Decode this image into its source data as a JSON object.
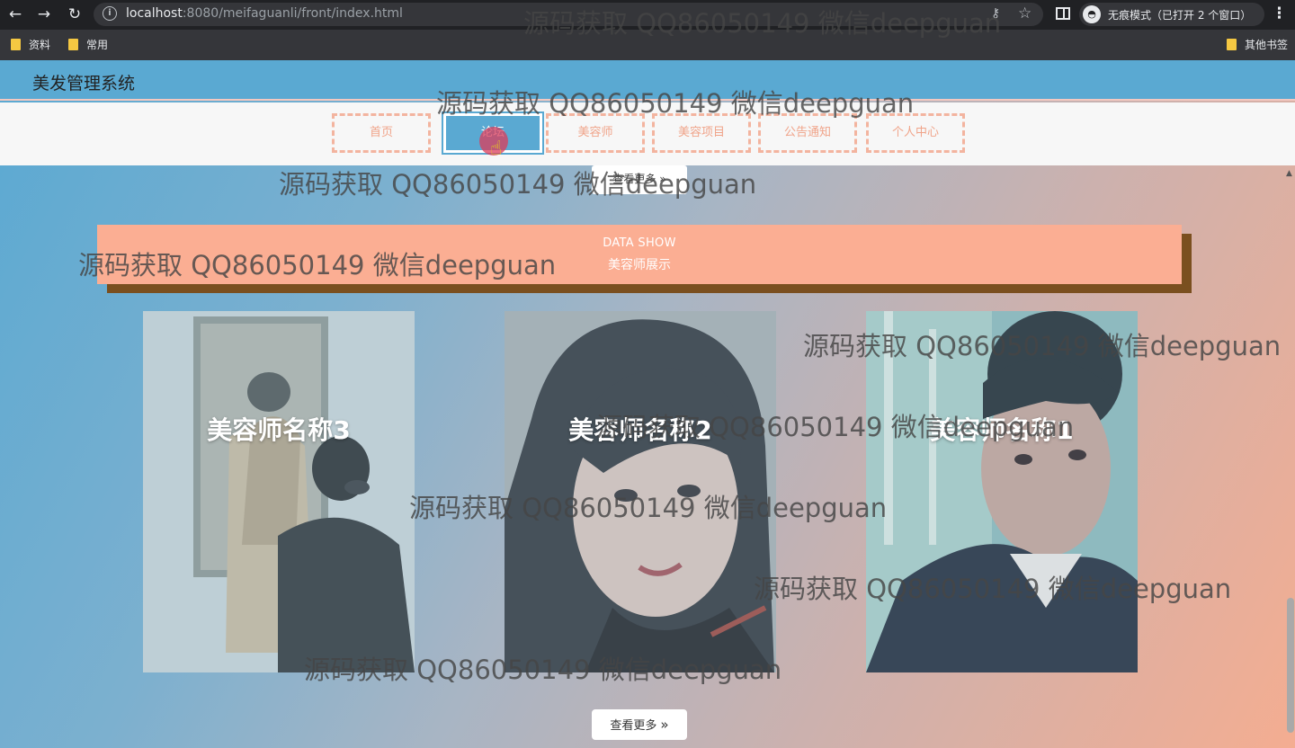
{
  "browser": {
    "url_host": "localhost",
    "url_rest": ":8080/meifaguanli/front/index.html",
    "incognito_label": "无痕模式（已打开 2 个窗口）",
    "bookmarks": [
      "资料",
      "常用"
    ],
    "other_bookmarks": "其他书签"
  },
  "site": {
    "title": "美发管理系统",
    "nav": [
      "首页",
      "论坛",
      "美容师",
      "美容项目",
      "公告通知",
      "个人中心"
    ],
    "active_nav": "论坛",
    "top_more_label": "查看更多 »"
  },
  "section": {
    "en_title": "DATA SHOW",
    "cn_title": "美容师展示"
  },
  "cards": [
    {
      "name": "美容师名称3"
    },
    {
      "name": "美容师名称2"
    },
    {
      "name": "美容师名称1"
    }
  ],
  "more_button": {
    "label": "查看更多",
    "arrow": "»"
  },
  "watermark": "源码获取 QQ86050149 微信deepguan"
}
